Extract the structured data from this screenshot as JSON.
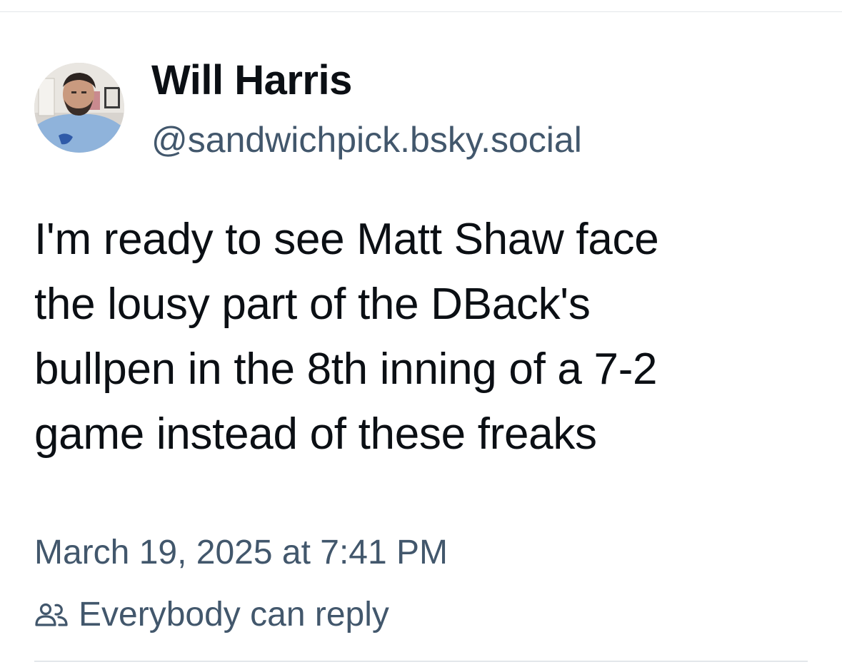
{
  "post": {
    "author": {
      "display_name": "Will Harris",
      "handle": "@sandwichpick.bsky.social"
    },
    "text": "I'm ready to see Matt Shaw face\nthe lousy part of the DBack's\nbullpen in the 8th inning of a 7-2\ngame instead of these freaks",
    "timestamp": "March 19, 2025 at 7:41 PM",
    "reply_setting": {
      "icon": "people-icon",
      "label": "Everybody can reply"
    }
  },
  "colors": {
    "text_primary": "#0b0f14",
    "text_secondary": "#42576c",
    "divider": "#e3e6ea"
  }
}
